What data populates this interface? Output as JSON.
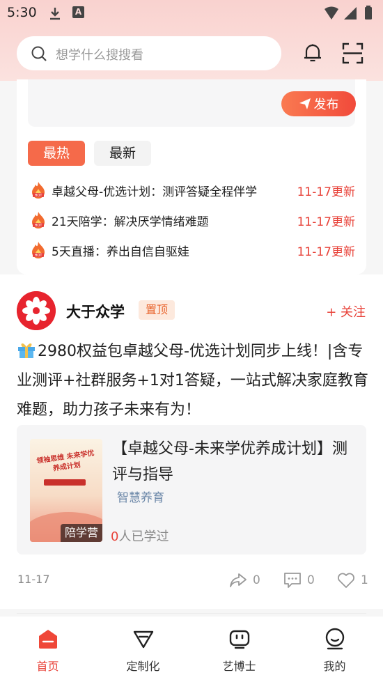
{
  "status_bar": {
    "time": "5:30",
    "icons": [
      "download-icon",
      "a-icon",
      "wifi-icon",
      "signal-icon",
      "battery-icon"
    ]
  },
  "header": {
    "search_placeholder": "想学什么搜搜看",
    "icons": [
      "search-icon",
      "bell-icon",
      "scan-icon"
    ]
  },
  "feed": {
    "publish_label": "发布",
    "tabs": [
      {
        "label": "最热",
        "active": true
      },
      {
        "label": "最新",
        "active": false
      }
    ],
    "hot_items": [
      {
        "title": "卓越父母-优选计划：测评答疑全程伴学",
        "update": "11-17更新"
      },
      {
        "title": "21天陪学：解决厌学情绪难题",
        "update": "11-17更新"
      },
      {
        "title": "5天直播：养出自信自驱娃",
        "update": "11-17更新"
      }
    ]
  },
  "post": {
    "author": "大于众学",
    "pinned_label": "置顶",
    "follow_label": "+ 关注",
    "text": "2980权益包卓越父母-优选计划同步上线！|含专业测评+社群服务+1对1答疑，一站式解决家庭教育难题，助力孩子未来有为！",
    "course": {
      "title": "【卓越父母-未来学优养成计划】测评与指导",
      "tag": "智慧养育",
      "cover_badge": "陪学营",
      "cover_text": "领袖思维 未来学优养成计划",
      "learned_count": "0",
      "learned_suffix": "人已学过"
    },
    "date": "11-17",
    "shares": "0",
    "comments": "0",
    "likes": "1"
  },
  "bottom_nav": [
    {
      "label": "首页",
      "icon": "home-icon",
      "active": true
    },
    {
      "label": "定制化",
      "icon": "customize-icon",
      "active": false
    },
    {
      "label": "艺博士",
      "icon": "robot-icon",
      "active": false
    },
    {
      "label": "我的",
      "icon": "profile-icon",
      "active": false
    }
  ],
  "colors": {
    "accent": "#e8433a",
    "header_bg": "#f9d2cf",
    "tag_blue": "#6b87a8"
  }
}
